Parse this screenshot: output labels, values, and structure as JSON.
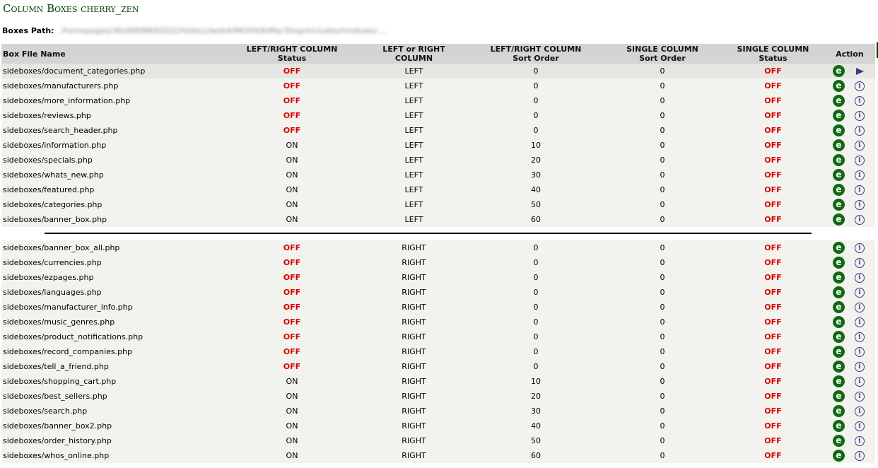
{
  "page": {
    "title": "Column Boxes cherry_zen",
    "path_label": "Boxes Path:",
    "path_value": "/homepages/36/d0898692022/htdocs/web4/96504/6/MacShop/includes/modules/ ..."
  },
  "colors": {
    "title": "#003d00",
    "off": "#d50000",
    "edit_icon": "#0f6a12",
    "info_icon": "#3a3a8c"
  },
  "table": {
    "headers": {
      "name": "Box File Name",
      "lr_status_1": "LEFT/RIGHT COLUMN",
      "lr_status_2": "Status",
      "lr_col_1": "LEFT or RIGHT",
      "lr_col_2": "COLUMN",
      "lr_sort_1": "LEFT/RIGHT COLUMN",
      "lr_sort_2": "Sort Order",
      "single_sort_1": "SINGLE COLUMN",
      "single_sort_2": "Sort Order",
      "single_status_1": "SINGLE COLUMN",
      "single_status_2": "Status",
      "action": "Action"
    },
    "icons": {
      "edit": "e",
      "info": "i"
    },
    "left_rows": [
      {
        "name": "sideboxes/document_categories.php",
        "status": "OFF",
        "column": "LEFT",
        "sort": "0",
        "single_sort": "0",
        "single_status": "OFF"
      },
      {
        "name": "sideboxes/manufacturers.php",
        "status": "OFF",
        "column": "LEFT",
        "sort": "0",
        "single_sort": "0",
        "single_status": "OFF"
      },
      {
        "name": "sideboxes/more_information.php",
        "status": "OFF",
        "column": "LEFT",
        "sort": "0",
        "single_sort": "0",
        "single_status": "OFF"
      },
      {
        "name": "sideboxes/reviews.php",
        "status": "OFF",
        "column": "LEFT",
        "sort": "0",
        "single_sort": "0",
        "single_status": "OFF"
      },
      {
        "name": "sideboxes/search_header.php",
        "status": "OFF",
        "column": "LEFT",
        "sort": "0",
        "single_sort": "0",
        "single_status": "OFF"
      },
      {
        "name": "sideboxes/information.php",
        "status": "ON",
        "column": "LEFT",
        "sort": "10",
        "single_sort": "0",
        "single_status": "OFF"
      },
      {
        "name": "sideboxes/specials.php",
        "status": "ON",
        "column": "LEFT",
        "sort": "20",
        "single_sort": "0",
        "single_status": "OFF"
      },
      {
        "name": "sideboxes/whats_new.php",
        "status": "ON",
        "column": "LEFT",
        "sort": "30",
        "single_sort": "0",
        "single_status": "OFF"
      },
      {
        "name": "sideboxes/featured.php",
        "status": "ON",
        "column": "LEFT",
        "sort": "40",
        "single_sort": "0",
        "single_status": "OFF"
      },
      {
        "name": "sideboxes/categories.php",
        "status": "ON",
        "column": "LEFT",
        "sort": "50",
        "single_sort": "0",
        "single_status": "OFF"
      },
      {
        "name": "sideboxes/banner_box.php",
        "status": "ON",
        "column": "LEFT",
        "sort": "60",
        "single_sort": "0",
        "single_status": "OFF"
      }
    ],
    "right_rows": [
      {
        "name": "sideboxes/banner_box_all.php",
        "status": "OFF",
        "column": "RIGHT",
        "sort": "0",
        "single_sort": "0",
        "single_status": "OFF"
      },
      {
        "name": "sideboxes/currencies.php",
        "status": "OFF",
        "column": "RIGHT",
        "sort": "0",
        "single_sort": "0",
        "single_status": "OFF"
      },
      {
        "name": "sideboxes/ezpages.php",
        "status": "OFF",
        "column": "RIGHT",
        "sort": "0",
        "single_sort": "0",
        "single_status": "OFF"
      },
      {
        "name": "sideboxes/languages.php",
        "status": "OFF",
        "column": "RIGHT",
        "sort": "0",
        "single_sort": "0",
        "single_status": "OFF"
      },
      {
        "name": "sideboxes/manufacturer_info.php",
        "status": "OFF",
        "column": "RIGHT",
        "sort": "0",
        "single_sort": "0",
        "single_status": "OFF"
      },
      {
        "name": "sideboxes/music_genres.php",
        "status": "OFF",
        "column": "RIGHT",
        "sort": "0",
        "single_sort": "0",
        "single_status": "OFF"
      },
      {
        "name": "sideboxes/product_notifications.php",
        "status": "OFF",
        "column": "RIGHT",
        "sort": "0",
        "single_sort": "0",
        "single_status": "OFF"
      },
      {
        "name": "sideboxes/record_companies.php",
        "status": "OFF",
        "column": "RIGHT",
        "sort": "0",
        "single_sort": "0",
        "single_status": "OFF"
      },
      {
        "name": "sideboxes/tell_a_friend.php",
        "status": "OFF",
        "column": "RIGHT",
        "sort": "0",
        "single_sort": "0",
        "single_status": "OFF"
      },
      {
        "name": "sideboxes/shopping_cart.php",
        "status": "ON",
        "column": "RIGHT",
        "sort": "10",
        "single_sort": "0",
        "single_status": "OFF"
      },
      {
        "name": "sideboxes/best_sellers.php",
        "status": "ON",
        "column": "RIGHT",
        "sort": "20",
        "single_sort": "0",
        "single_status": "OFF"
      },
      {
        "name": "sideboxes/search.php",
        "status": "ON",
        "column": "RIGHT",
        "sort": "30",
        "single_sort": "0",
        "single_status": "OFF"
      },
      {
        "name": "sideboxes/banner_box2.php",
        "status": "ON",
        "column": "RIGHT",
        "sort": "40",
        "single_sort": "0",
        "single_status": "OFF"
      },
      {
        "name": "sideboxes/order_history.php",
        "status": "ON",
        "column": "RIGHT",
        "sort": "50",
        "single_sort": "0",
        "single_status": "OFF"
      },
      {
        "name": "sideboxes/whos_online.php",
        "status": "ON",
        "column": "RIGHT",
        "sort": "60",
        "single_sort": "0",
        "single_status": "OFF"
      }
    ],
    "selected_row": 0
  }
}
